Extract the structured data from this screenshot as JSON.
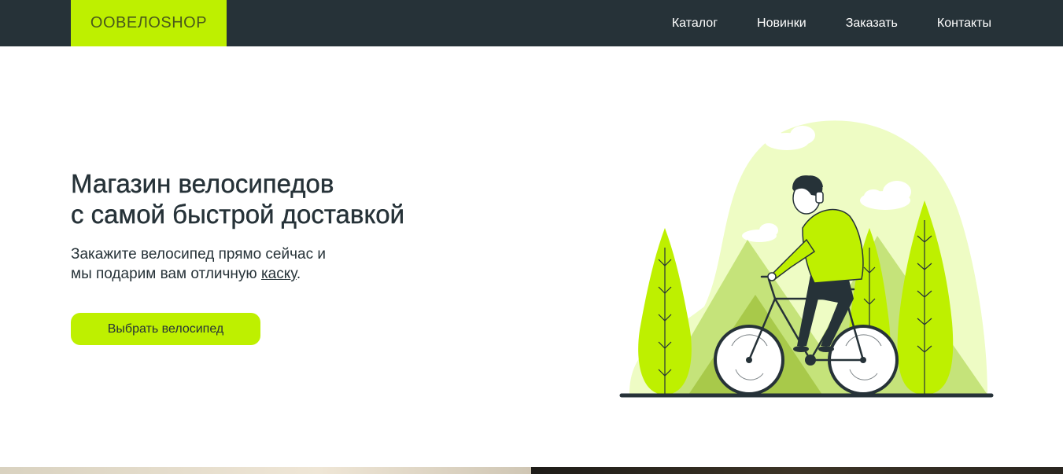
{
  "header": {
    "logo": "OOBEЛOSHOP",
    "nav": [
      "Каталог",
      "Новинки",
      "Заказать",
      "Контакты"
    ]
  },
  "hero": {
    "title_line1": "Магазин велосипедов",
    "title_line2": "с самой быстрой доставкой",
    "subtitle_line1": "Закажите велосипед прямо сейчас и",
    "subtitle_line2_prefix": "мы подарим вам отличную ",
    "subtitle_link": "каску",
    "subtitle_line2_suffix": ".",
    "cta_label": "Выбрать велосипед"
  },
  "colors": {
    "accent": "#bef000",
    "dark": "#263238"
  },
  "icons": {
    "illustration": "cyclist-illustration"
  }
}
